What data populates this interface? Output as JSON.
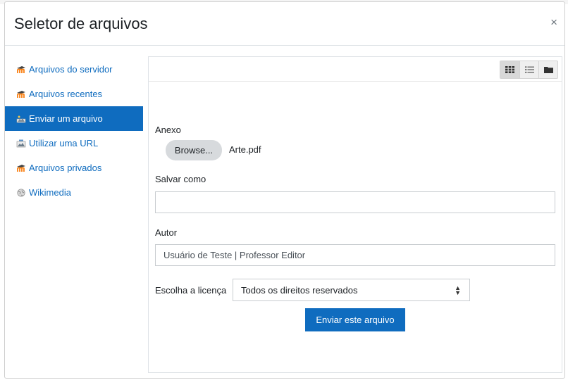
{
  "dialog": {
    "title": "Seletor de arquivos",
    "close_symbol": "×"
  },
  "sidebar": {
    "items": [
      {
        "label": "Arquivos do servidor",
        "icon": "moodle-icon"
      },
      {
        "label": "Arquivos recentes",
        "icon": "moodle-icon"
      },
      {
        "label": "Enviar um arquivo",
        "icon": "upload-icon",
        "active": true
      },
      {
        "label": "Utilizar uma URL",
        "icon": "url-icon"
      },
      {
        "label": "Arquivos privados",
        "icon": "moodle-icon"
      },
      {
        "label": "Wikimedia",
        "icon": "wikimedia-icon"
      }
    ]
  },
  "toolbar": {
    "views": [
      "grid-view-icon",
      "list-view-icon",
      "folder-view-icon"
    ]
  },
  "form": {
    "attachment_label": "Anexo",
    "browse_label": "Browse...",
    "selected_file": "Arte.pdf",
    "save_as_label": "Salvar como",
    "save_as_value": "",
    "author_label": "Autor",
    "author_value": "Usuário de Teste | Professor Editor",
    "license_label": "Escolha a licença",
    "license_value": "Todos os direitos reservados",
    "submit_label": "Enviar este arquivo"
  },
  "colors": {
    "accent": "#0f6cbf",
    "moodle_orange": "#f98012"
  }
}
